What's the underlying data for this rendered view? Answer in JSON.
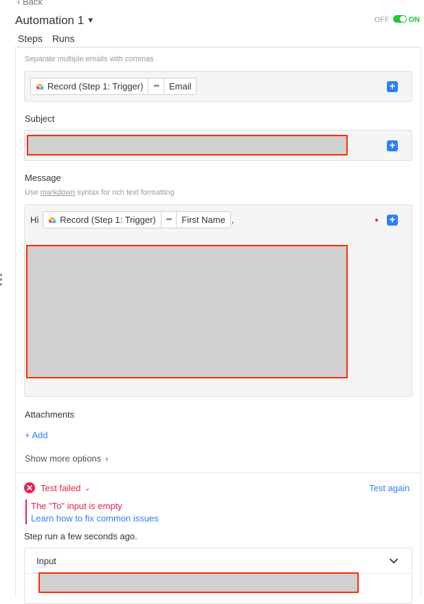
{
  "nav": {
    "back_label": "‹ Back"
  },
  "header": {
    "title": "Automation 1",
    "toggle": {
      "off_label": "OFF",
      "on_label": "ON",
      "state": "on"
    }
  },
  "tabs": [
    {
      "label": "Steps",
      "active": true
    },
    {
      "label": "Runs",
      "active": false
    }
  ],
  "to_field": {
    "hint": "Separate multiple emails with commas",
    "token": {
      "source": "Record (Step 1: Trigger)",
      "more": "•••",
      "field": "Email"
    }
  },
  "subject_field": {
    "label": "Subject"
  },
  "message_field": {
    "label": "Message",
    "hint_prefix": "Use ",
    "hint_link": "markdown",
    "hint_suffix": " syntax for rich text formatting",
    "greeting": "Hi",
    "token": {
      "source": "Record (Step 1: Trigger)",
      "more": "•••",
      "field": "First Name"
    },
    "after_token": ","
  },
  "attachments": {
    "label": "Attachments",
    "add_label": "+ Add"
  },
  "more_options": {
    "label": "Show more options"
  },
  "test": {
    "status": "Test failed",
    "retry_label": "Test again",
    "error": "The \"To\" input is empty",
    "help_link": "Learn how to fix common issues",
    "run_time": "Step run a few seconds ago."
  },
  "input_section": {
    "label": "Input"
  },
  "colors": {
    "accent": "#2d7ff9",
    "error": "#e0244a",
    "toggle_on": "#20c933",
    "redaction_border": "#ff2a00"
  }
}
